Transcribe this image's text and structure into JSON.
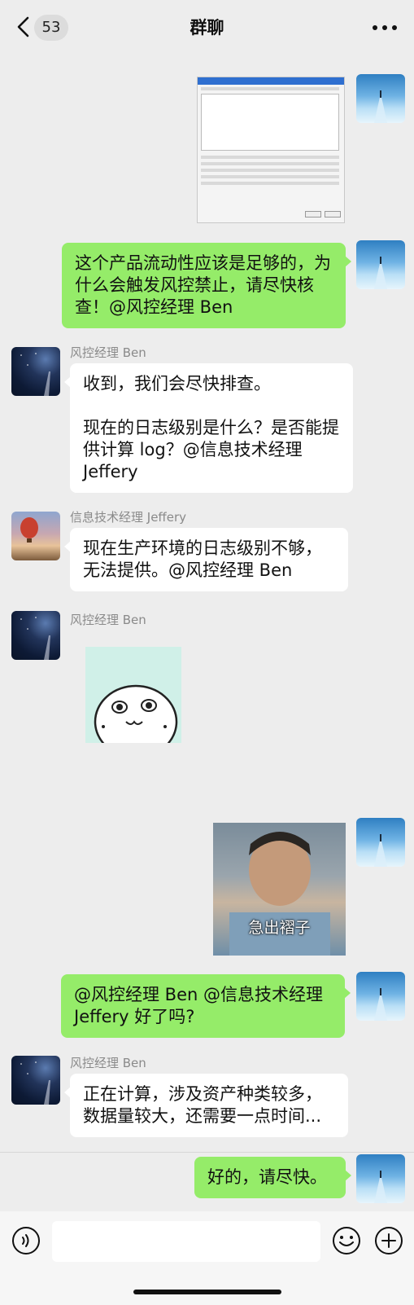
{
  "header": {
    "title": "群聊",
    "unread_count": "53"
  },
  "messages": [
    {
      "sender": "",
      "type": "image",
      "desc": "screenshot"
    },
    {
      "sender": "",
      "text": "这个产品流动性应该是足够的，为什么会触发风控禁止，请尽快核查！@风控经理 Ben"
    },
    {
      "sender": "风控经理 Ben",
      "text": "收到，我们会尽快排查。\n\n现在的日志级别是什么？是否能提供计算 log？@信息技术经理 Jeffery"
    },
    {
      "sender": "信息技术经理 Jeffery",
      "text": "现在生产环境的日志级别不够，无法提供。@风控经理 Ben"
    },
    {
      "sender": "风控经理 Ben",
      "type": "sticker"
    },
    {
      "sender": "",
      "type": "meme",
      "caption": "急出褶子"
    },
    {
      "sender": "",
      "text": "@风控经理 Ben @信息技术经理 Jeffery 好了吗?"
    },
    {
      "sender": "风控经理 Ben",
      "text": "正在计算，涉及资产种类较多，数据量较大，还需要一点时间..."
    },
    {
      "sender": "",
      "text": "好的，请尽快。"
    }
  ],
  "colors": {
    "own_bubble": "#95ec69",
    "other_bubble": "#ffffff",
    "background": "#ededed"
  }
}
